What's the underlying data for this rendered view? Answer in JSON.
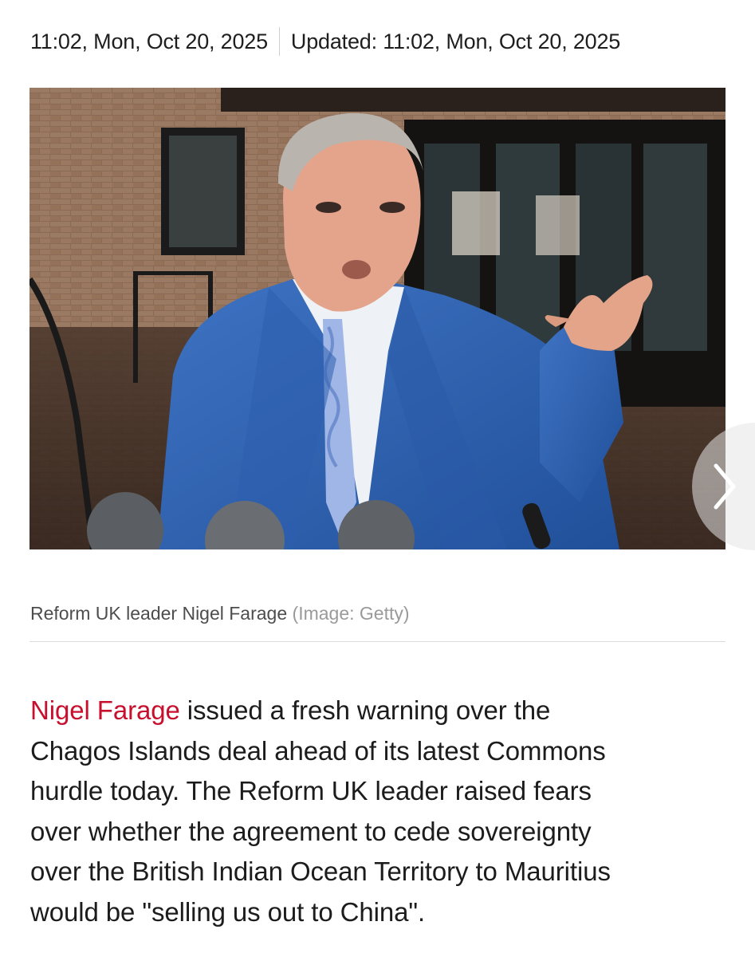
{
  "article": {
    "published": "11:02, Mon, Oct 20, 2025",
    "updated": "Updated: 11:02, Mon, Oct 20, 2025",
    "image_caption": "Reform UK leader Nigel Farage",
    "image_credit": "(Image: Getty)",
    "body": {
      "link_text": "Nigel Farage",
      "line1_rest": " issued a fresh warning over the",
      "line2": "Chagos Islands deal ahead of its latest Commons",
      "line3": "hurdle today. The Reform UK leader raised fears",
      "line4": "over whether the agreement to cede sovereignty",
      "line5": "over the British Indian Ocean Territory to Mauritius",
      "line6": "would be \"selling us out to China\"."
    }
  },
  "icons": {
    "next": "chevron-right-icon"
  },
  "colors": {
    "link": "#c8102e",
    "caption_credit": "#9a9a9a"
  }
}
